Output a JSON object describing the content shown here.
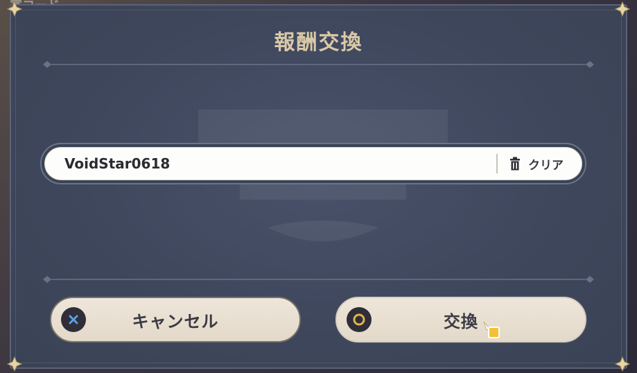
{
  "background": {
    "partial_text": "賞コード"
  },
  "dialog": {
    "title": "報酬交換",
    "code_input": {
      "value": "VoidStar0618",
      "clear_label": "クリア"
    },
    "buttons": {
      "cancel_label": "キャンセル",
      "confirm_label": "交換"
    }
  },
  "icons": {
    "corner": "ornament-corner-icon",
    "trash": "trash-icon",
    "cancel": "cross-icon",
    "confirm": "circle-icon",
    "cursor": "pointer-cursor-icon"
  },
  "colors": {
    "title": "#d9c9a6",
    "dialog_bg": "#434b61",
    "button_bg": "#e9e0d2",
    "cancel_icon": "#5aa0e6",
    "confirm_icon": "#e0b54a",
    "cursor": "#f2c234"
  }
}
